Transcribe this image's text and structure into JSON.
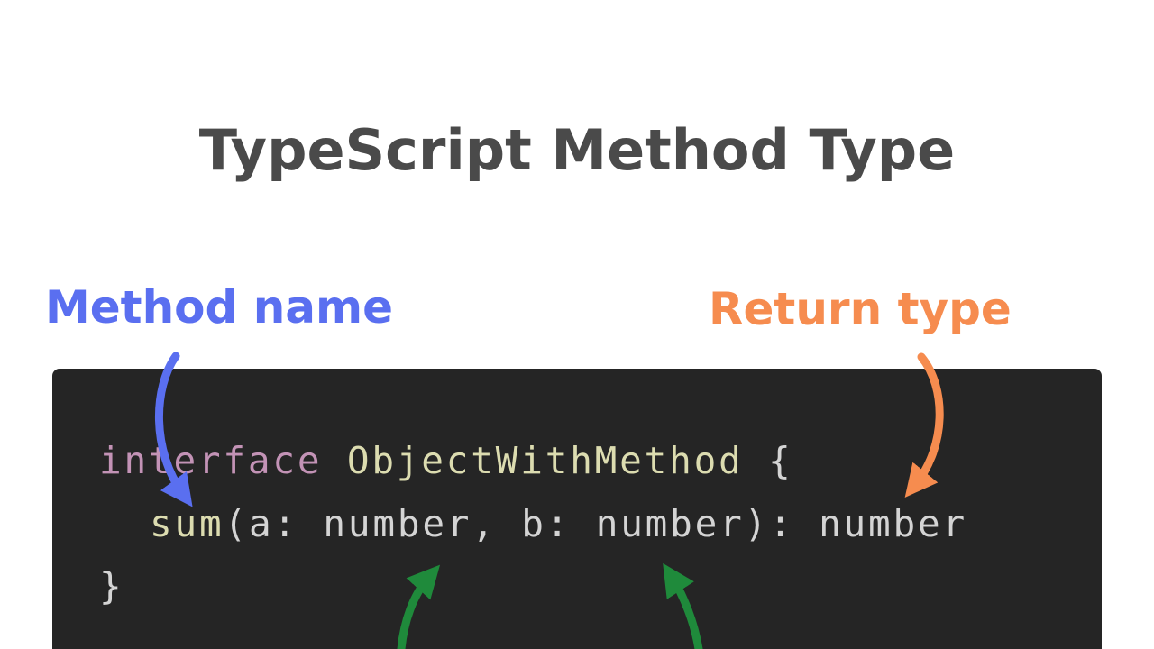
{
  "title": "TypeScript Method Type",
  "labels": {
    "method_name": "Method name",
    "return_type": "Return type"
  },
  "code": {
    "line1": {
      "keyword": "interface",
      "name": "ObjectWithMethod",
      "brace_open": "{"
    },
    "line2": {
      "method": "sum",
      "paren_open": "(",
      "param_a": "a",
      "colon_a": ": ",
      "type_a": "number",
      "comma": ", ",
      "param_b": "b",
      "colon_b": ": ",
      "type_b": "number",
      "paren_close": ")",
      "colon_ret": ": ",
      "return_type": "number"
    },
    "line3": {
      "brace_close": "}"
    }
  },
  "colors": {
    "title": "#4a4a4a",
    "method_arrow": "#5a6ff0",
    "return_arrow": "#f68c4f",
    "param_arrow": "#1f8a3b",
    "code_background": "#252525",
    "keyword": "#c393b6",
    "type_name": "#dcdcb0"
  },
  "icons": {
    "method_arrow": "curved-arrow-icon",
    "return_arrow": "curved-arrow-icon",
    "param_a_arrow": "curved-arrow-icon",
    "param_b_arrow": "curved-arrow-icon"
  }
}
